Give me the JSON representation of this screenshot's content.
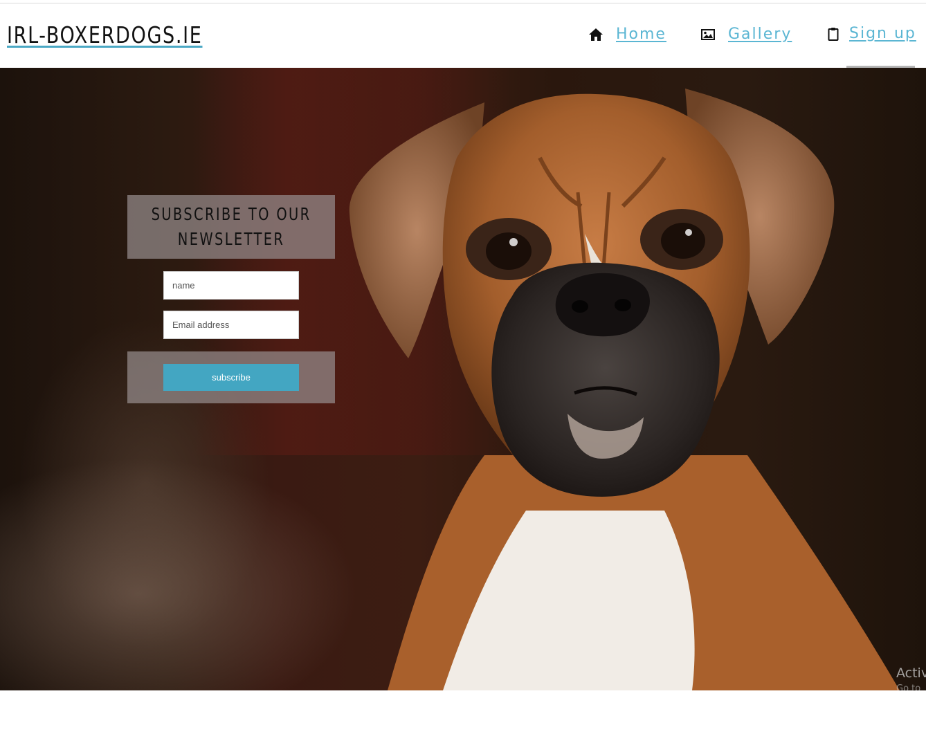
{
  "header": {
    "logo": "IRL-BOXERDOGS.IE",
    "nav": [
      {
        "label": "Home",
        "icon": "home-icon"
      },
      {
        "label": "Gallery",
        "icon": "image-icon"
      },
      {
        "label": "Sign up",
        "icon": "clipboard-icon"
      }
    ],
    "active_nav": "Sign up",
    "link_color": "#5bb6d3"
  },
  "hero": {
    "image": "boxer-dog-photo"
  },
  "newsletter": {
    "title_line1": "SUBSCRIBE TO OUR",
    "title_line2": "NEWSLETTER",
    "name_placeholder": "name",
    "email_placeholder": "Email address",
    "button_label": "subscribe",
    "button_color": "#43a6c2"
  },
  "os_watermark": {
    "line1": "Activ",
    "line2": "Go to"
  }
}
